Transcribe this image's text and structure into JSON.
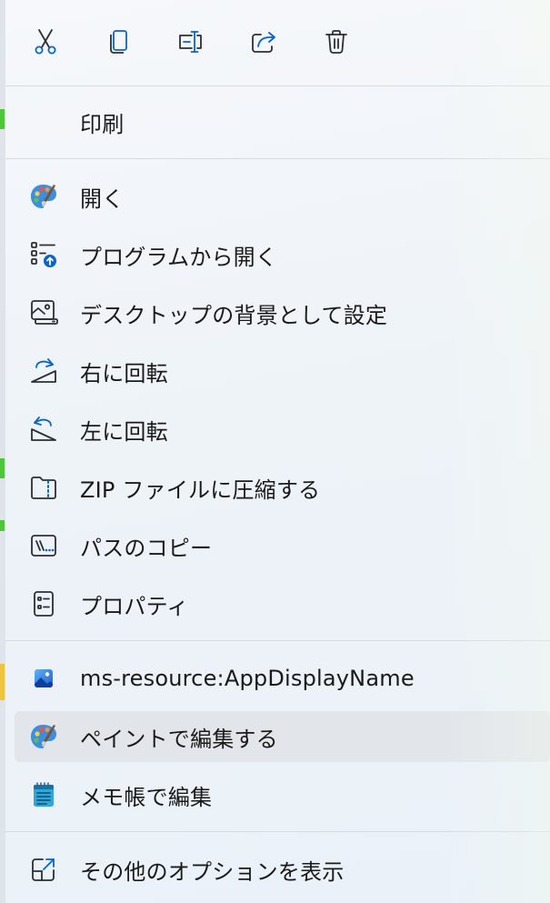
{
  "toolbar": {
    "buttons": [
      {
        "icon": "scissors-icon",
        "action": "cut"
      },
      {
        "icon": "copy-icon",
        "action": "copy"
      },
      {
        "icon": "rename-icon",
        "action": "rename"
      },
      {
        "icon": "share-icon",
        "action": "share"
      },
      {
        "icon": "trash-icon",
        "action": "delete"
      }
    ]
  },
  "menu": {
    "print": "印刷",
    "open": "開く",
    "open_with": "プログラムから開く",
    "set_wallpaper": "デスクトップの背景として設定",
    "rotate_right": "右に回転",
    "rotate_left": "左に回転",
    "zip": "ZIP ファイルに圧縮する",
    "copy_path": "パスのコピー",
    "properties": "プロパティ",
    "app_display": "ms-resource:AppDisplayName",
    "edit_paint": "ペイントで編集する",
    "edit_notepad": "メモ帳で編集",
    "more_options": "その他のオプションを表示"
  },
  "colors": {
    "accent": "#0a64c8",
    "icon_stroke": "#2b2f36",
    "hover_bg": "#e2e6eb",
    "separator": "#d6dbe1"
  }
}
